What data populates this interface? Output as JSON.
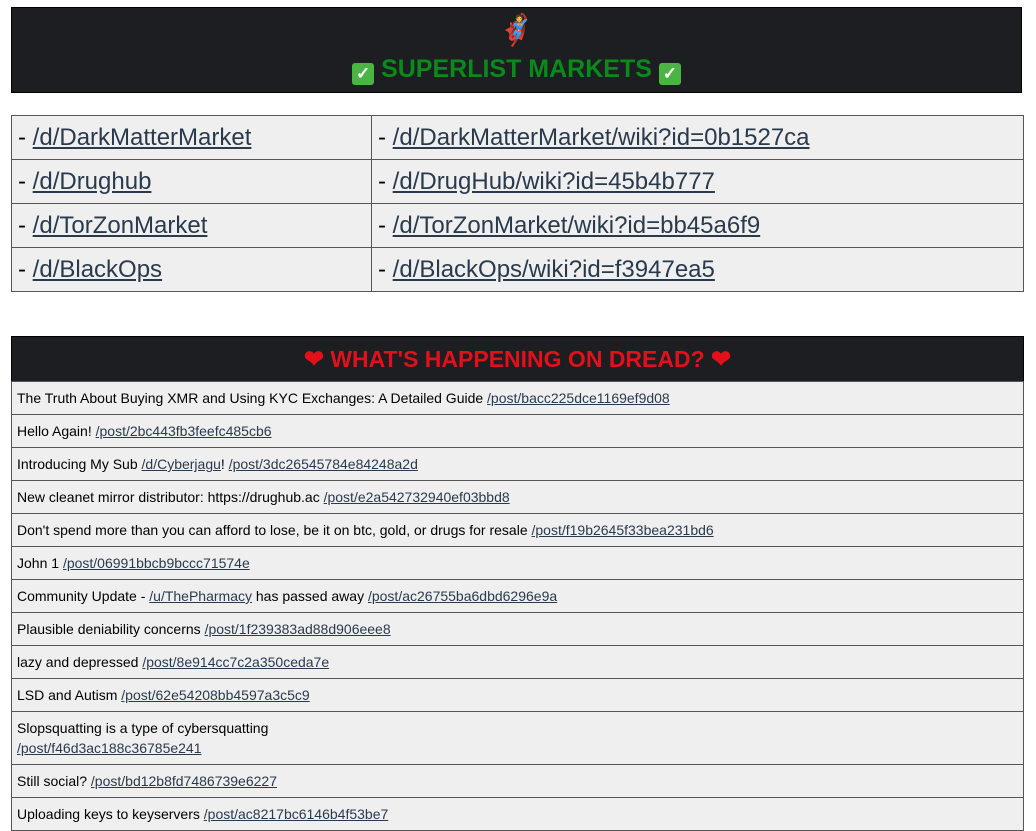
{
  "banner": {
    "emoji": "🦸",
    "title": "SUPERLIST MARKETS",
    "check": "✓"
  },
  "markets": [
    {
      "sub": "/d/DarkMatterMarket",
      "wiki": "/d/DarkMatterMarket/wiki?id=0b1527ca"
    },
    {
      "sub": "/d/Drughub",
      "wiki": "/d/DrugHub/wiki?id=45b4b777"
    },
    {
      "sub": "/d/TorZonMarket",
      "wiki": "/d/TorZonMarket/wiki?id=bb45a6f9"
    },
    {
      "sub": "/d/BlackOps",
      "wiki": "/d/BlackOps/wiki?id=f3947ea5"
    }
  ],
  "happening": {
    "heart": "❤",
    "title": "WHAT'S HAPPENING ON DREAD?"
  },
  "posts": [
    {
      "text": "The Truth About Buying XMR and Using KYC Exchanges: A Detailed Guide",
      "link": "/post/bacc225dce1169ef9d08"
    },
    {
      "text": "Hello Again!",
      "link": "/post/2bc443fb3feefc485cb6"
    },
    {
      "text": "Introducing My Sub",
      "sublink": "/d/Cyberjagu",
      "mid": "!",
      "link": "/post/3dc26545784e84248a2d"
    },
    {
      "text": "New cleanet mirror distributor: https://drughub.ac",
      "link": "/post/e2a542732940ef03bbd8"
    },
    {
      "text": "Don't spend more than you can afford to lose, be it on btc, gold, or drugs for resale",
      "link": "/post/f19b2645f33bea231bd6"
    },
    {
      "text": "John 1",
      "link": "/post/06991bbcb9bccc71574e"
    },
    {
      "text": "Community Update -",
      "sublink": "/u/ThePharmacy",
      "mid": "has passed away",
      "link": "/post/ac26755ba6dbd6296e9a"
    },
    {
      "text": "Plausible deniability concerns",
      "link": "/post/1f239383ad88d906eee8"
    },
    {
      "text": "lazy and depressed",
      "link": "/post/8e914cc7c2a350ceda7e"
    },
    {
      "text": "LSD and Autism",
      "link": "/post/62e54208bb4597a3c5c9"
    },
    {
      "text": "Slopsquatting is a type of cybersquatting",
      "link": "/post/f46d3ac188c36785e241",
      "break": true
    },
    {
      "text": "Still social?",
      "link": "/post/bd12b8fd7486739e6227"
    },
    {
      "text": "Uploading keys to keyservers",
      "link": "/post/ac8217bc6146b4f53be7"
    }
  ]
}
